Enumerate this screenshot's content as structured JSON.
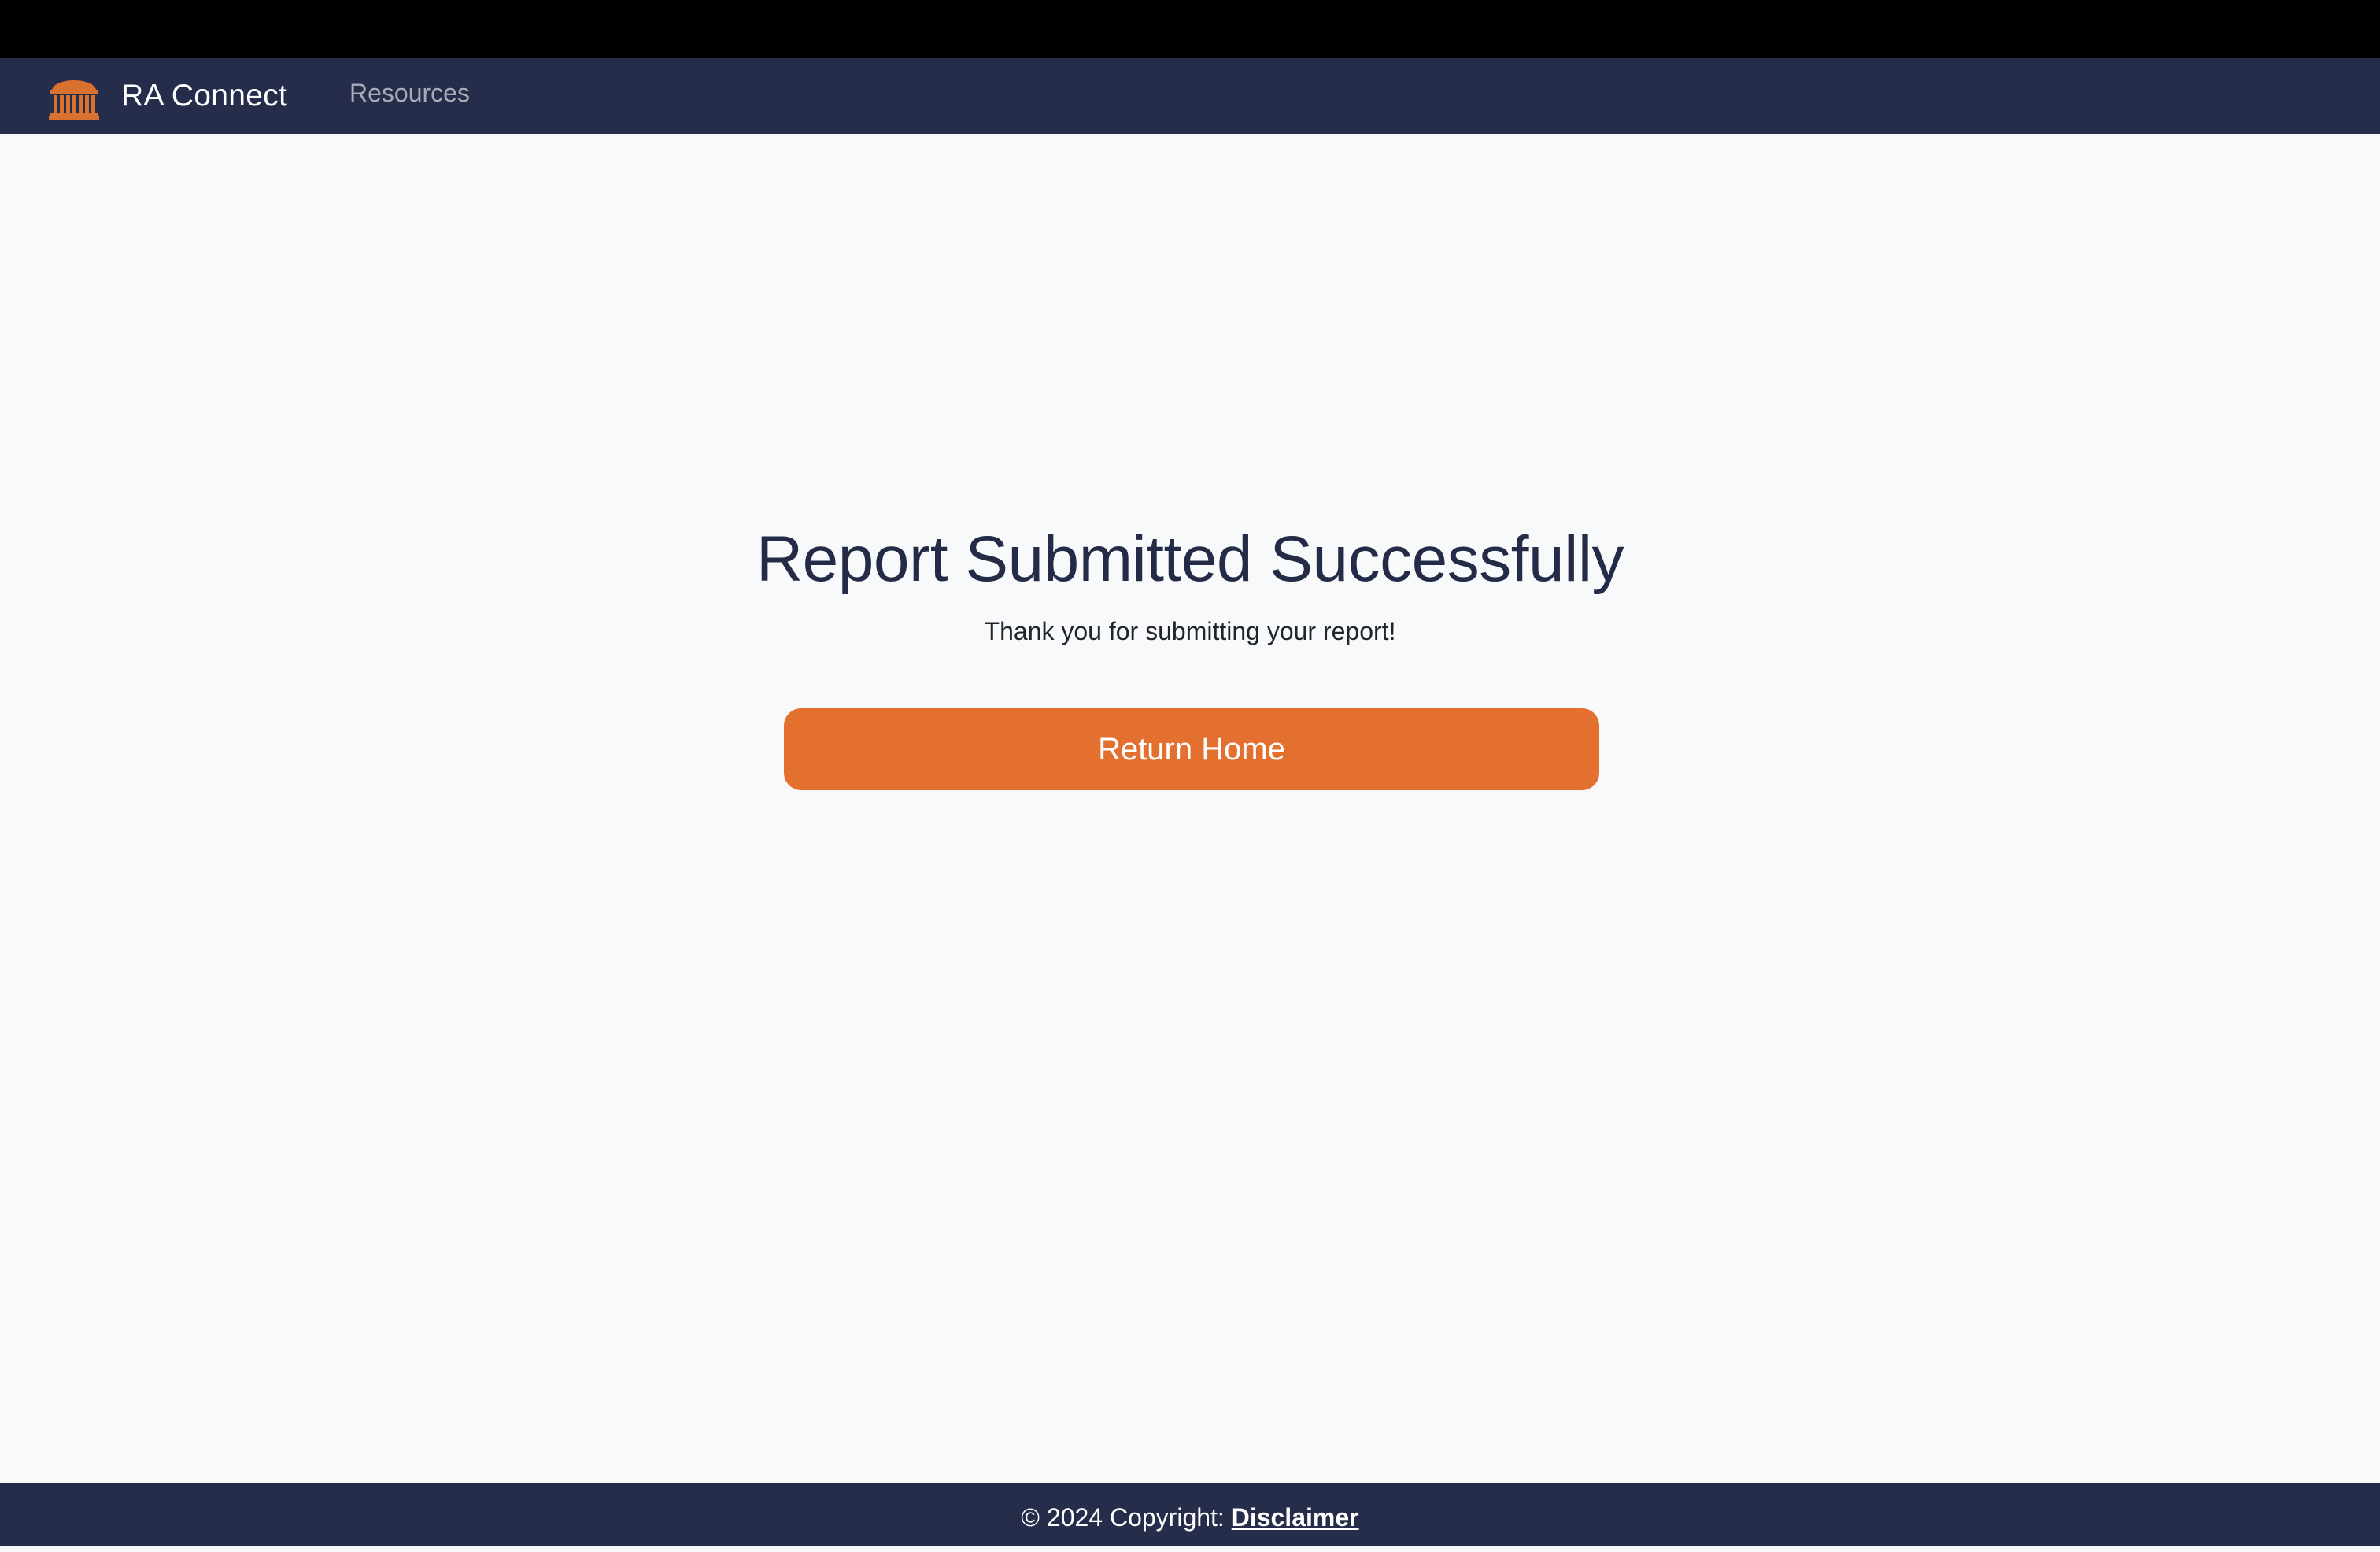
{
  "navbar": {
    "brand_name": "RA Connect",
    "logo_icon": "rotunda-building-icon",
    "links": [
      {
        "label": "Resources"
      }
    ]
  },
  "main": {
    "title": "Report Submitted Successfully",
    "message": "Thank you for submitting your report!",
    "return_button_label": "Return Home"
  },
  "footer": {
    "copyright_text": "© 2024 Copyright: ",
    "disclaimer_label": "Disclaimer"
  },
  "colors": {
    "navbar_bg": "#252d4a",
    "accent_orange": "#e3702f",
    "title_text": "#232b47",
    "page_bg": "#f8f9fa"
  }
}
